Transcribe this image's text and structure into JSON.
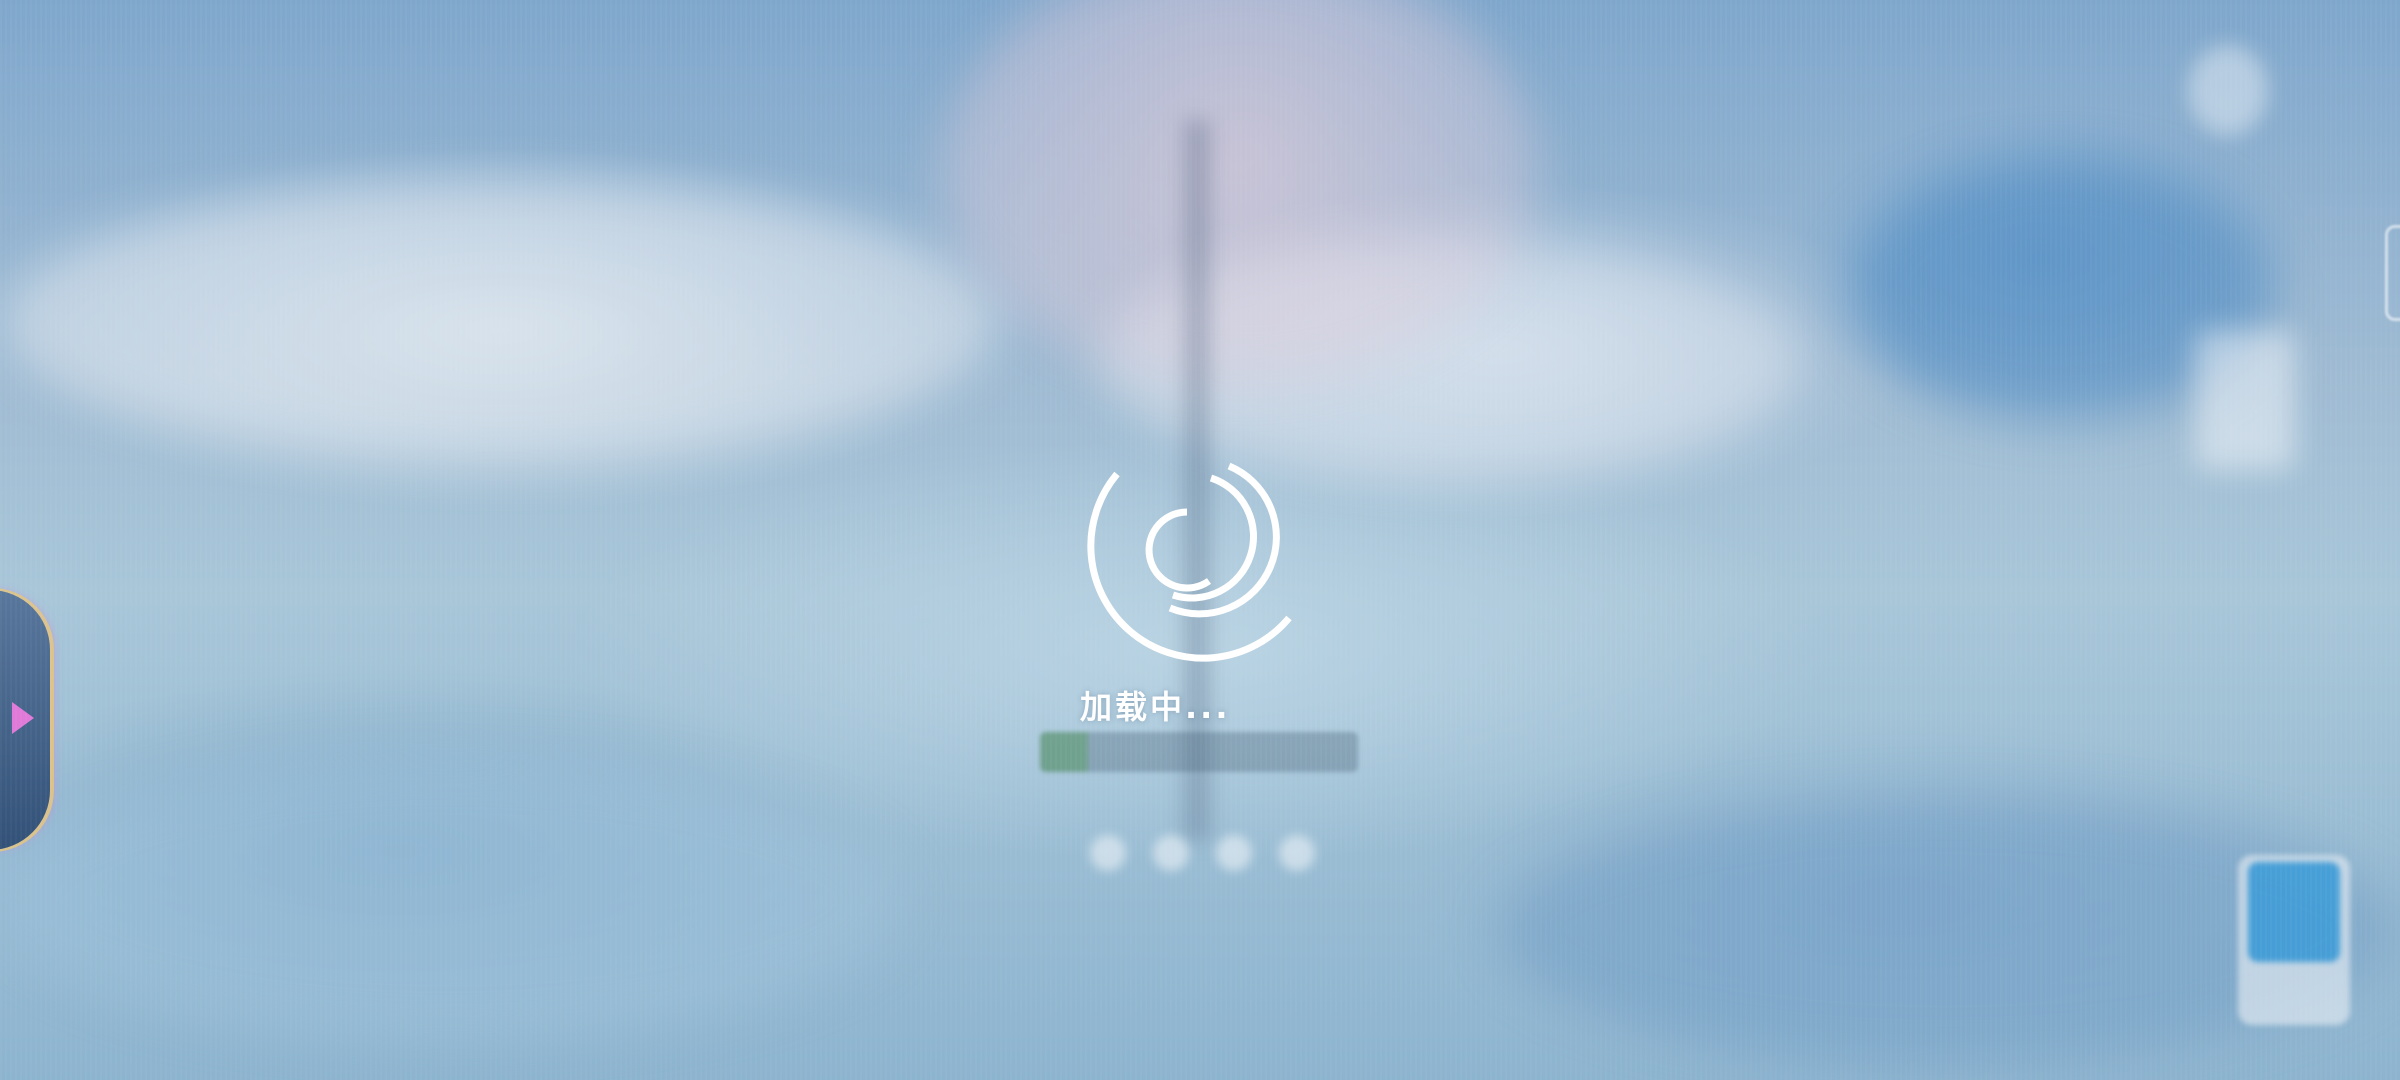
{
  "loading": {
    "text": "加载中..."
  },
  "progress": {
    "fraction": 0.15
  },
  "icons": {
    "spinner": "loading-spinner-icon",
    "side_arrow": "chevron-right-icon"
  },
  "colors": {
    "spinner": "#ffffff",
    "side_arrow": "#e07ad8"
  }
}
